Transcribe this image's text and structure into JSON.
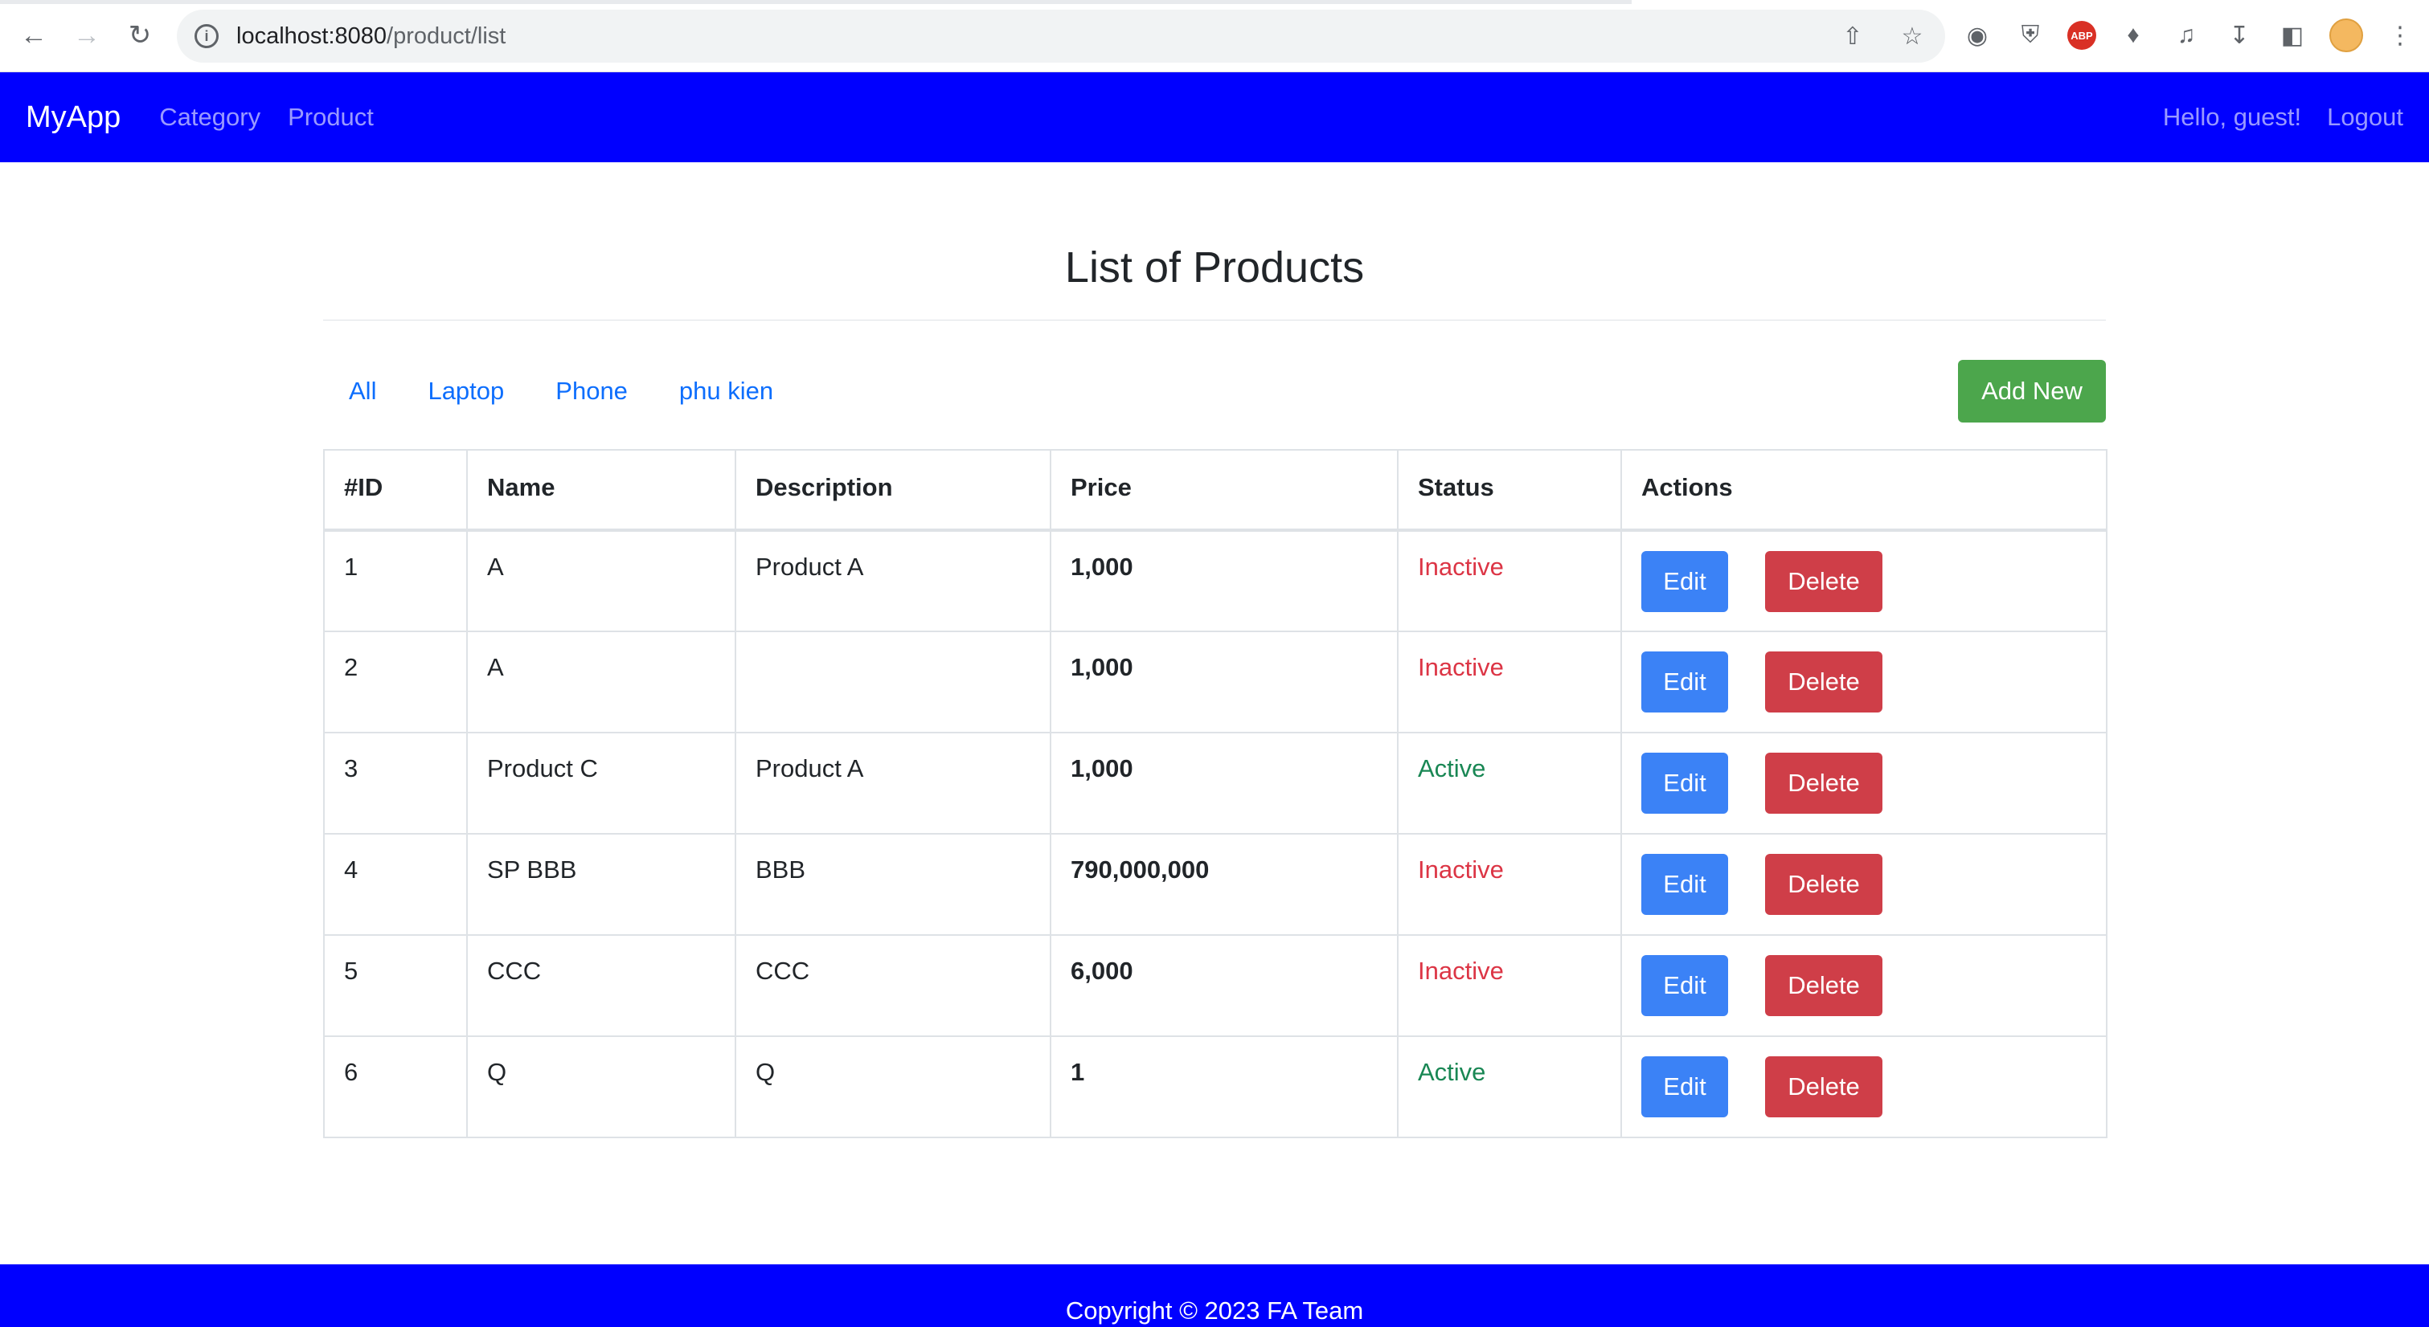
{
  "browser": {
    "url_host": "localhost:8080",
    "url_path": "/product/list"
  },
  "navbar": {
    "brand": "MyApp",
    "links": [
      "Category",
      "Product"
    ],
    "greeting": "Hello, guest!",
    "logout": "Logout",
    "color": "#0000ff"
  },
  "page": {
    "title": "List of Products",
    "filters": [
      "All",
      "Laptop",
      "Phone",
      "phu kien"
    ],
    "add_new": "Add New"
  },
  "table": {
    "headers": [
      "#ID",
      "Name",
      "Description",
      "Price",
      "Status",
      "Actions"
    ],
    "rows": [
      {
        "id": "1",
        "name": "A",
        "description": "Product A",
        "price": "1,000",
        "status": "Inactive"
      },
      {
        "id": "2",
        "name": "A",
        "description": "",
        "price": "1,000",
        "status": "Inactive"
      },
      {
        "id": "3",
        "name": "Product C",
        "description": "Product A",
        "price": "1,000",
        "status": "Active"
      },
      {
        "id": "4",
        "name": "SP BBB",
        "description": "BBB",
        "price": "790,000,000",
        "status": "Inactive"
      },
      {
        "id": "5",
        "name": "CCC",
        "description": "CCC",
        "price": "6,000",
        "status": "Inactive"
      },
      {
        "id": "6",
        "name": "Q",
        "description": "Q",
        "price": "1",
        "status": "Active"
      }
    ],
    "edit_label": "Edit",
    "delete_label": "Delete"
  },
  "footer": {
    "text": "Copyright © 2023 FA Team"
  },
  "colors": {
    "inactive": "#dc3545",
    "active": "#198754",
    "edit": "#3b82f6",
    "delete": "#cf3e48",
    "add": "#4ca64c"
  }
}
